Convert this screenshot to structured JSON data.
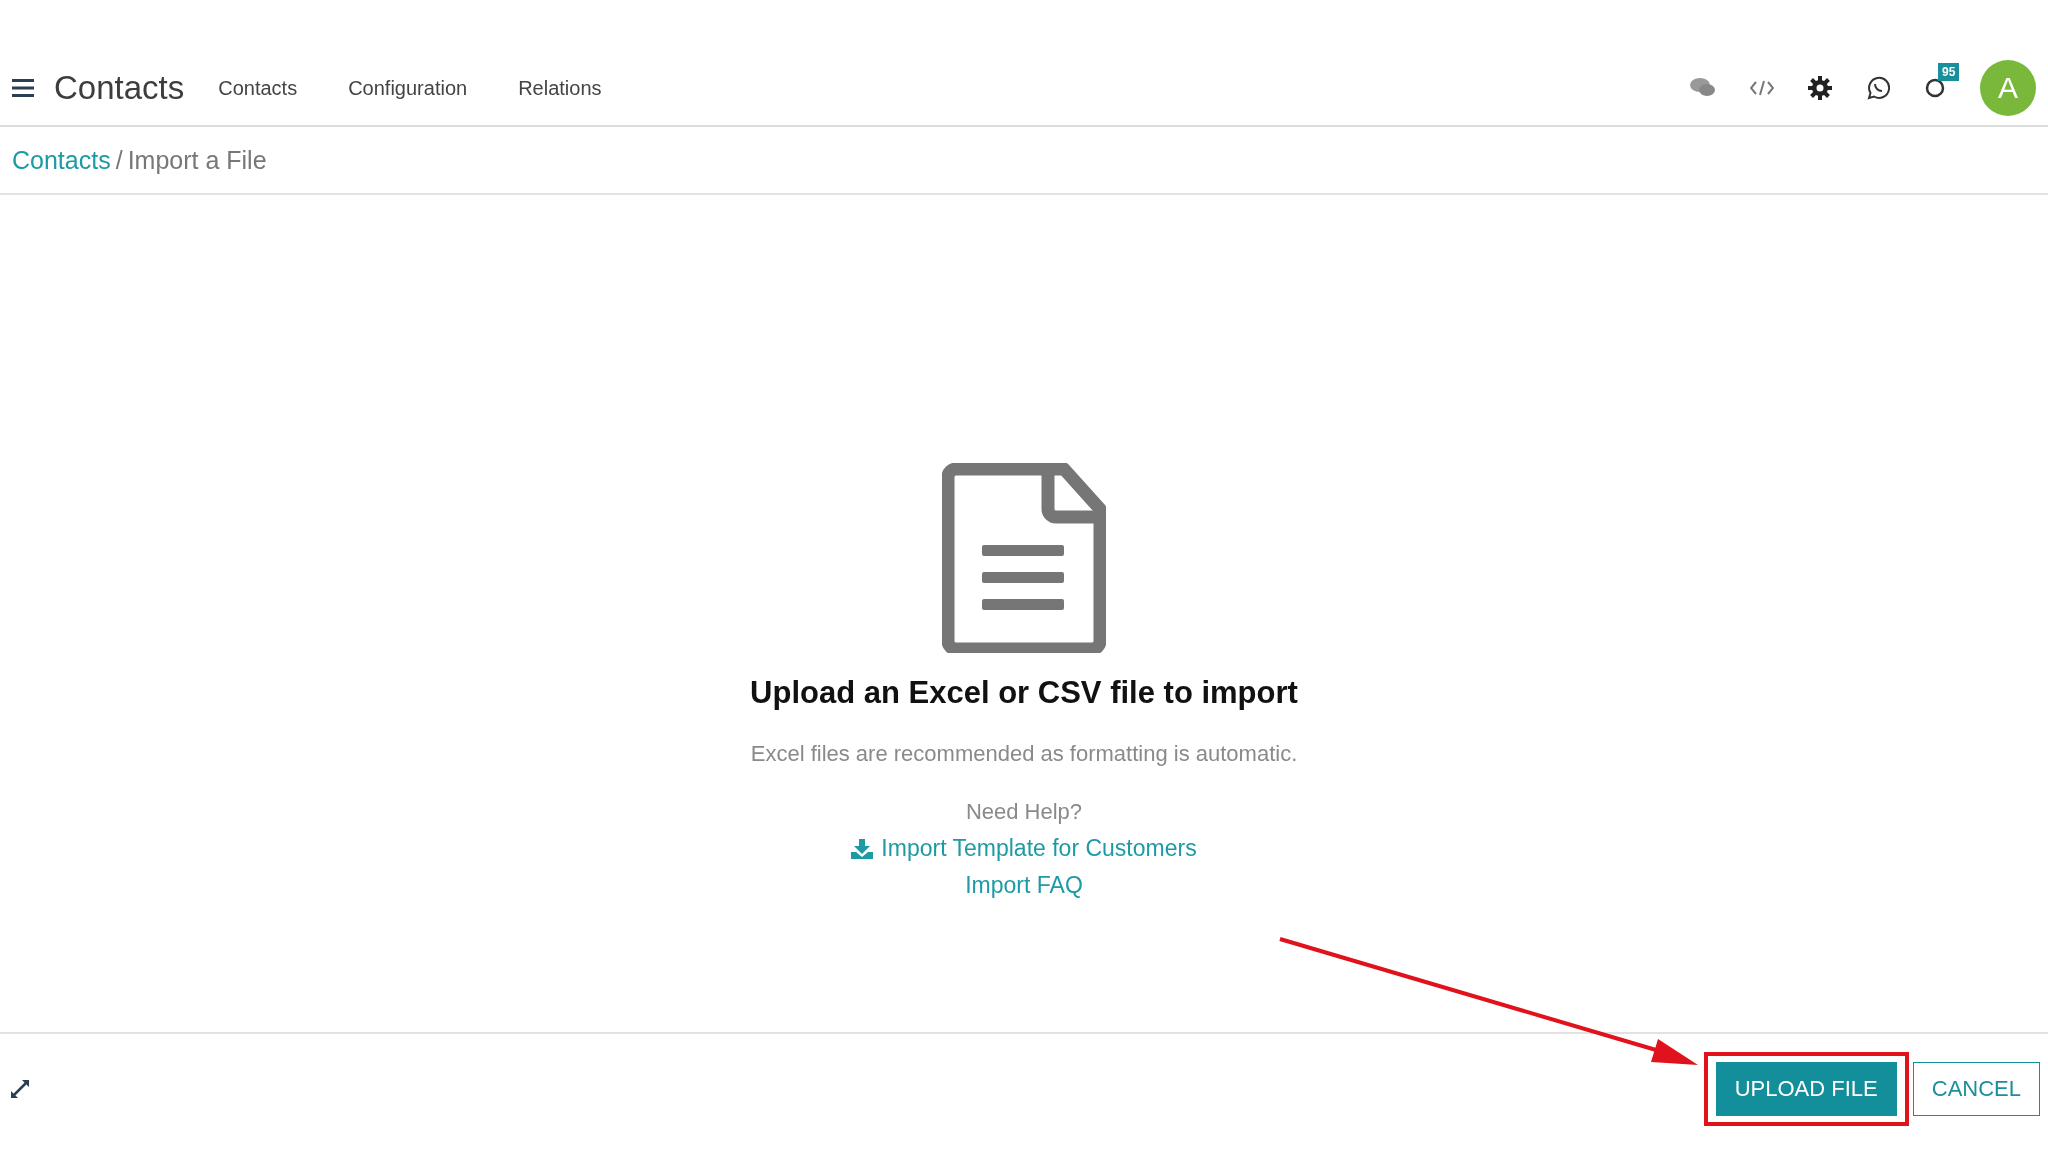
{
  "navbar": {
    "app_title": "Contacts",
    "menu": [
      {
        "label": "Contacts"
      },
      {
        "label": "Configuration"
      },
      {
        "label": "Relations"
      }
    ],
    "activity_badge": "95",
    "avatar_letter": "A"
  },
  "breadcrumb": {
    "parent": "Contacts",
    "separator": "/",
    "current": "Import a File"
  },
  "empty_state": {
    "title": "Upload an Excel or CSV file to import",
    "subtitle": "Excel files are recommended as formatting is automatic.",
    "help_label": "Need Help?",
    "links": [
      {
        "label": "Import Template for Customers",
        "kind": "download"
      },
      {
        "label": "Import FAQ",
        "kind": "plain"
      }
    ]
  },
  "footer": {
    "buttons": [
      {
        "label": "UPLOAD FILE",
        "kind": "primary",
        "highlighted": true
      },
      {
        "label": "CANCEL",
        "kind": "secondary",
        "highlighted": false
      }
    ]
  }
}
